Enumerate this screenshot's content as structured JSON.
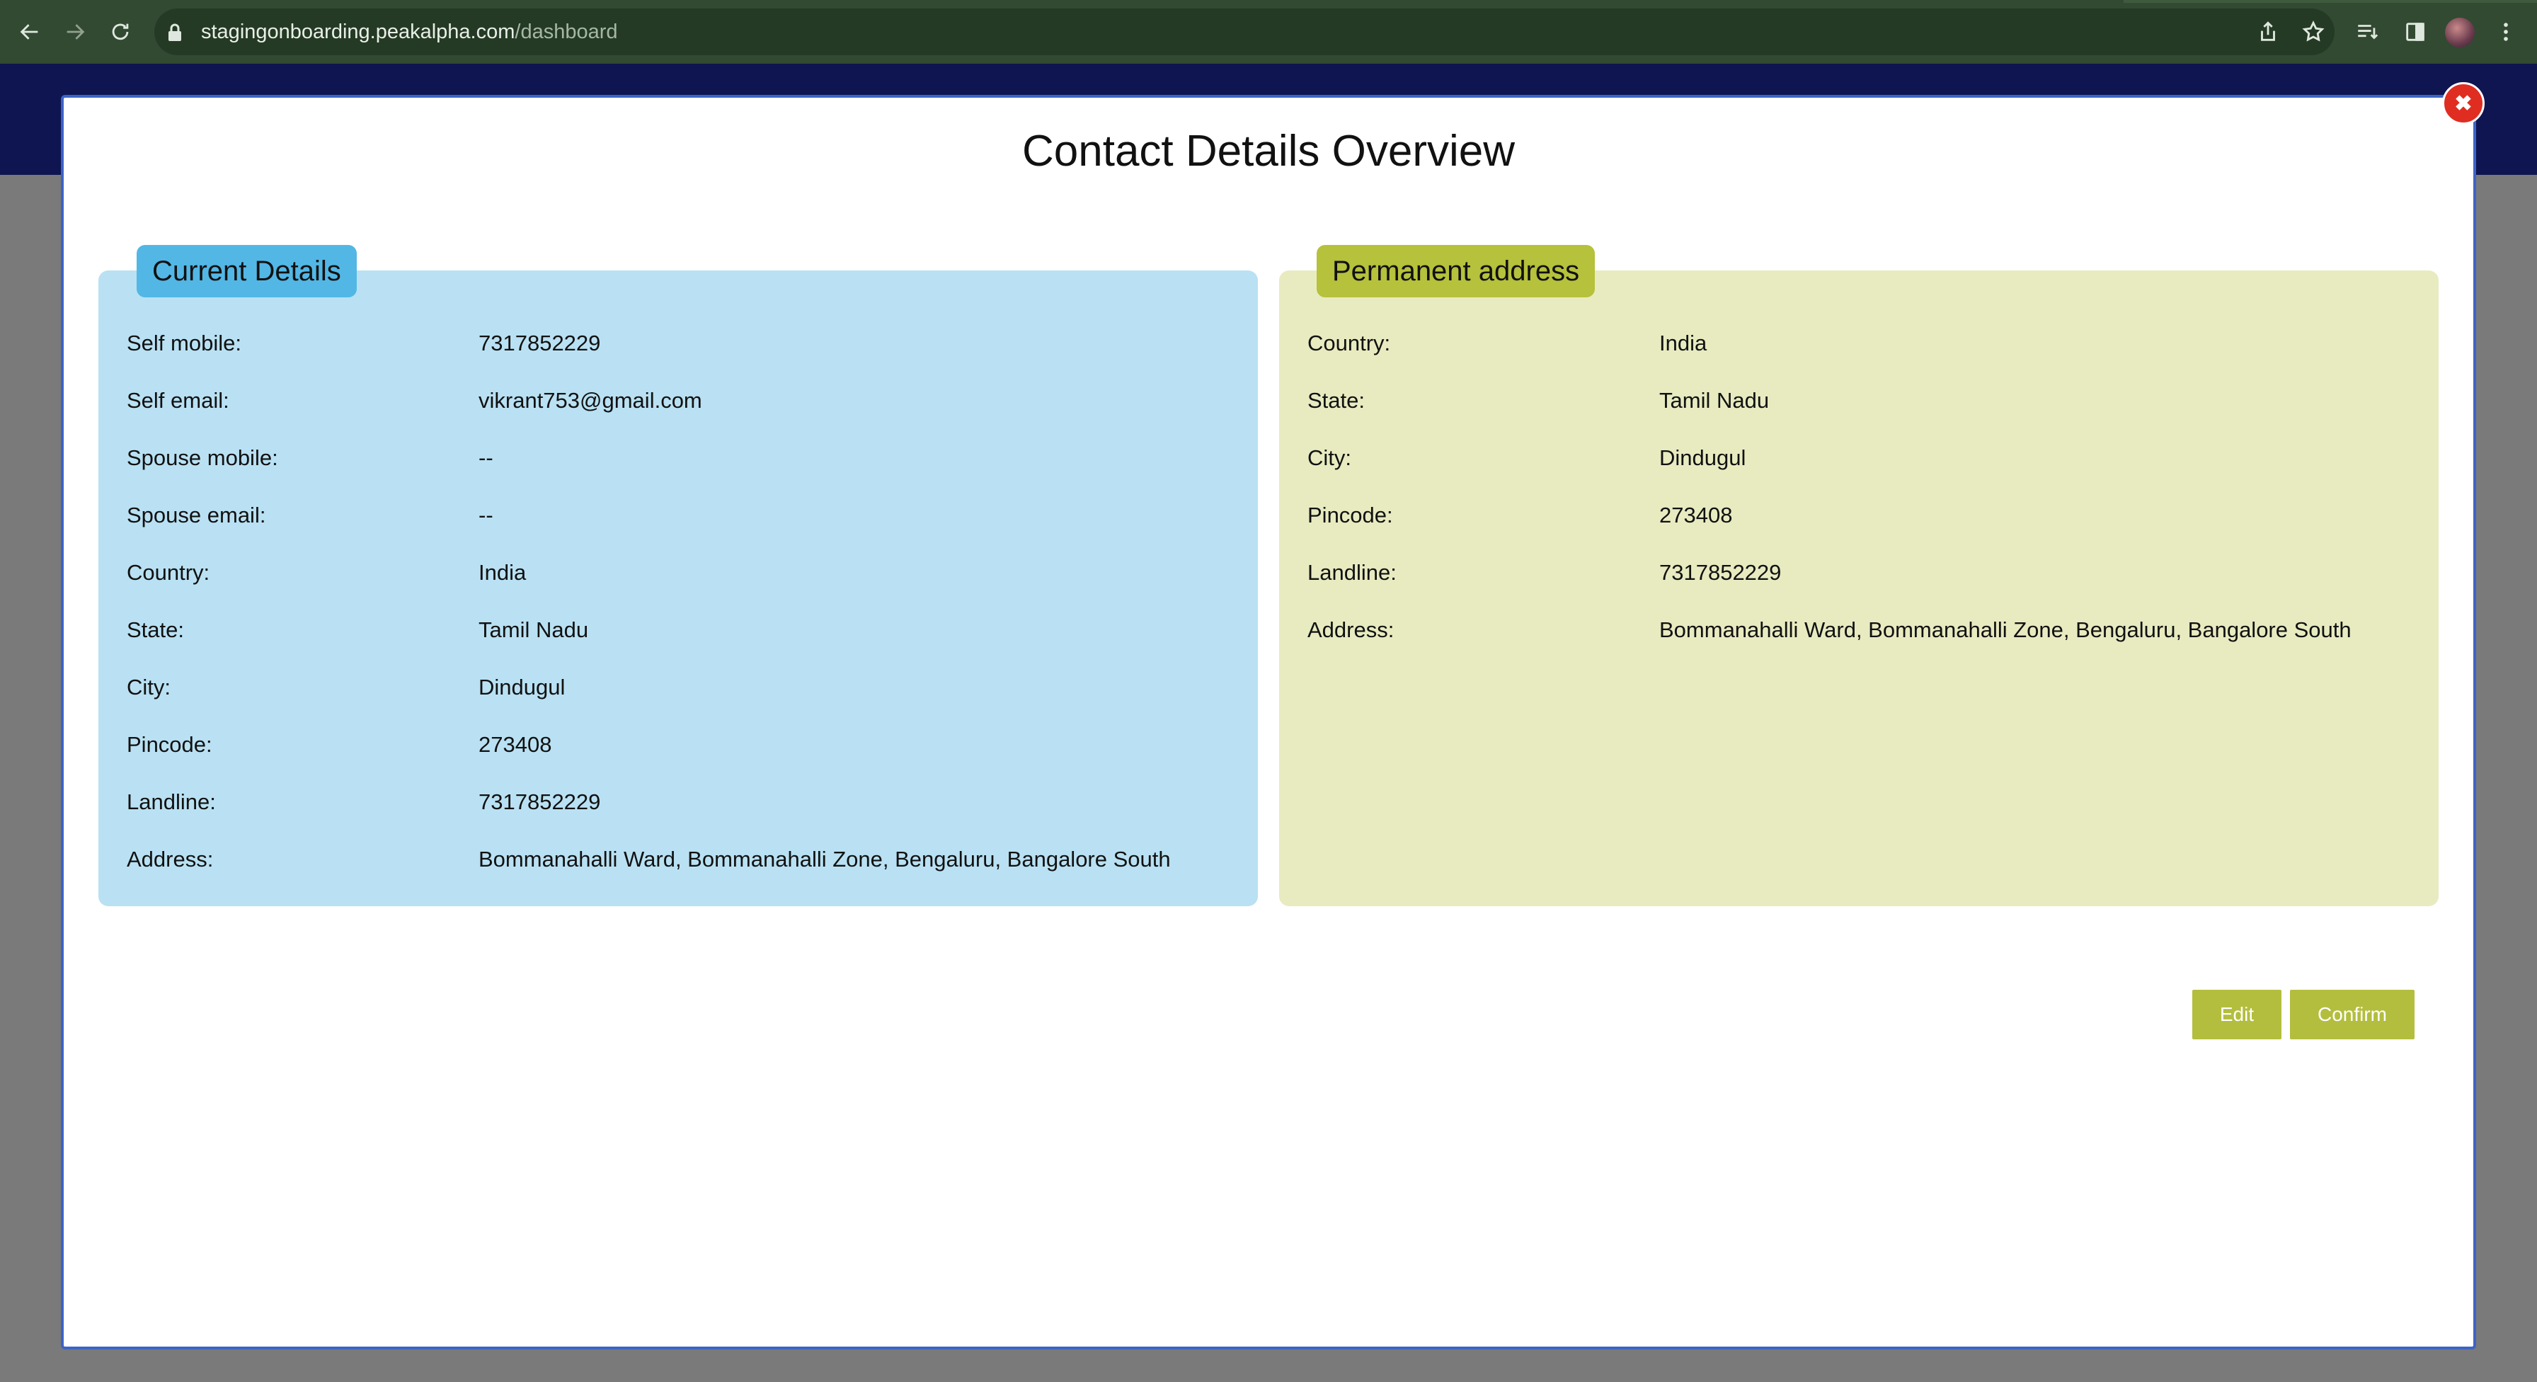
{
  "browser": {
    "url_domain": "stagingonboarding.peakalpha.com",
    "url_path": "/dashboard"
  },
  "modal": {
    "title": "Contact Details Overview",
    "close_label": "✖",
    "current": {
      "heading": "Current Details",
      "rows": [
        {
          "label": "Self mobile:",
          "value": "7317852229"
        },
        {
          "label": "Self email:",
          "value": "vikrant753@gmail.com"
        },
        {
          "label": "Spouse mobile:",
          "value": "--"
        },
        {
          "label": "Spouse email:",
          "value": "--"
        },
        {
          "label": "Country:",
          "value": "India"
        },
        {
          "label": "State:",
          "value": "Tamil Nadu"
        },
        {
          "label": "City:",
          "value": "Dindugul"
        },
        {
          "label": "Pincode:",
          "value": "273408"
        },
        {
          "label": "Landline:",
          "value": "7317852229"
        },
        {
          "label": "Address:",
          "value": "Bommanahalli Ward, Bommanahalli Zone, Bengaluru, Bangalore South"
        }
      ]
    },
    "permanent": {
      "heading": "Permanent address",
      "rows": [
        {
          "label": "Country:",
          "value": "India"
        },
        {
          "label": "State:",
          "value": "Tamil Nadu"
        },
        {
          "label": "City:",
          "value": "Dindugul"
        },
        {
          "label": "Pincode:",
          "value": "273408"
        },
        {
          "label": "Landline:",
          "value": "7317852229"
        },
        {
          "label": "Address:",
          "value": "Bommanahalli Ward, Bommanahalli Zone, Bengaluru, Bangalore South"
        }
      ]
    },
    "actions": {
      "edit_label": "Edit",
      "confirm_label": "Confirm"
    }
  },
  "colors": {
    "current_panel": "#b9e1f3",
    "current_tag": "#52b7e5",
    "permanent_panel": "#e8ebc0",
    "permanent_tag": "#b6c13c",
    "button": "#b3be3e",
    "close_button": "#e02d22",
    "page_header": "#0e1550"
  }
}
